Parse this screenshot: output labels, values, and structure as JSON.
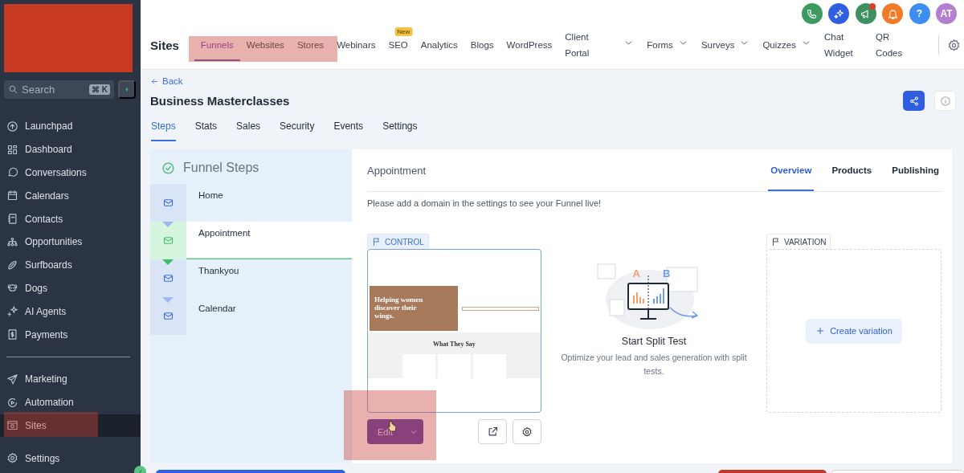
{
  "sidebar": {
    "search": {
      "placeholder": "Search",
      "shortcut": "⌘ K"
    },
    "items": [
      {
        "label": "Launchpad",
        "selected": false
      },
      {
        "label": "Dashboard",
        "selected": false
      },
      {
        "label": "Conversations",
        "selected": false
      },
      {
        "label": "Calendars",
        "selected": false
      },
      {
        "label": "Contacts",
        "selected": false
      },
      {
        "label": "Opportunities",
        "selected": false
      },
      {
        "label": "Surfboards",
        "selected": false
      },
      {
        "label": "Dogs",
        "selected": false
      },
      {
        "label": "AI Agents",
        "selected": false
      },
      {
        "label": "Payments",
        "selected": false
      }
    ],
    "items_2": [
      {
        "label": "Marketing",
        "selected": false
      },
      {
        "label": "Automation",
        "selected": false
      },
      {
        "label": "Sites",
        "selected": true
      }
    ],
    "footer": {
      "label": "Settings"
    }
  },
  "header": {
    "title": "Sites",
    "actions": [
      {
        "kind": "phone",
        "color": "#3c9a5f"
      },
      {
        "kind": "sparkle",
        "color": "#2f5fe0"
      },
      {
        "kind": "megaphone",
        "color": "#3f9060",
        "badge": true
      },
      {
        "kind": "bell",
        "color": "#f27b2a"
      },
      {
        "kind": "help",
        "color": "#3d8ef0",
        "text": "?"
      },
      {
        "kind": "avatar",
        "color": "#b47fcf",
        "text": "AT"
      }
    ],
    "tabs": [
      {
        "label": "Funnels",
        "selected": true
      },
      {
        "label": "Websites",
        "selected": false
      },
      {
        "label": "Stores",
        "selected": false
      },
      {
        "label": "Webinars",
        "selected": false
      },
      {
        "label": "SEO",
        "selected": false,
        "badge": "New"
      },
      {
        "label": "Analytics",
        "selected": false
      },
      {
        "label": "Blogs",
        "selected": false
      },
      {
        "label": "WordPress",
        "selected": false
      },
      {
        "label": "Client Portal",
        "selected": false,
        "dropdown": true
      },
      {
        "label": "Forms",
        "selected": false,
        "dropdown": true
      },
      {
        "label": "Surveys",
        "selected": false,
        "dropdown": true
      },
      {
        "label": "Quizzes",
        "selected": false,
        "dropdown": true
      },
      {
        "label": "Chat Widget",
        "selected": false
      },
      {
        "label": "QR Codes",
        "selected": false
      }
    ]
  },
  "page": {
    "back": "Back",
    "title": "Business Masterclasses",
    "tabs": [
      {
        "label": "Steps",
        "selected": true
      },
      {
        "label": "Stats",
        "selected": false
      },
      {
        "label": "Sales",
        "selected": false
      },
      {
        "label": "Security",
        "selected": false
      },
      {
        "label": "Events",
        "selected": false
      },
      {
        "label": "Settings",
        "selected": false
      }
    ]
  },
  "steps": {
    "title": "Funnel Steps",
    "items": [
      {
        "label": "Home",
        "selected": false
      },
      {
        "label": "Appointment",
        "selected": true
      },
      {
        "label": "Thankyou",
        "selected": false
      },
      {
        "label": "Calendar",
        "selected": false
      }
    ]
  },
  "detail": {
    "title": "Appointment",
    "tabs": [
      {
        "label": "Overview",
        "selected": true
      },
      {
        "label": "Products",
        "selected": false
      },
      {
        "label": "Publishing",
        "selected": false
      }
    ],
    "notice": "Please add a domain in the settings to see your Funnel live!",
    "control": {
      "label": "CONTROL",
      "preview_heading": "Helping women discover their wings.",
      "preview_section": "What They Say",
      "edit": "Edit"
    },
    "split_test": {
      "variants": [
        "A",
        "B"
      ],
      "title": "Start Split Test",
      "description": "Optimize your lead and sales generation with split tests."
    },
    "variation": {
      "label": "VARIATION",
      "create": "Create variation"
    }
  }
}
